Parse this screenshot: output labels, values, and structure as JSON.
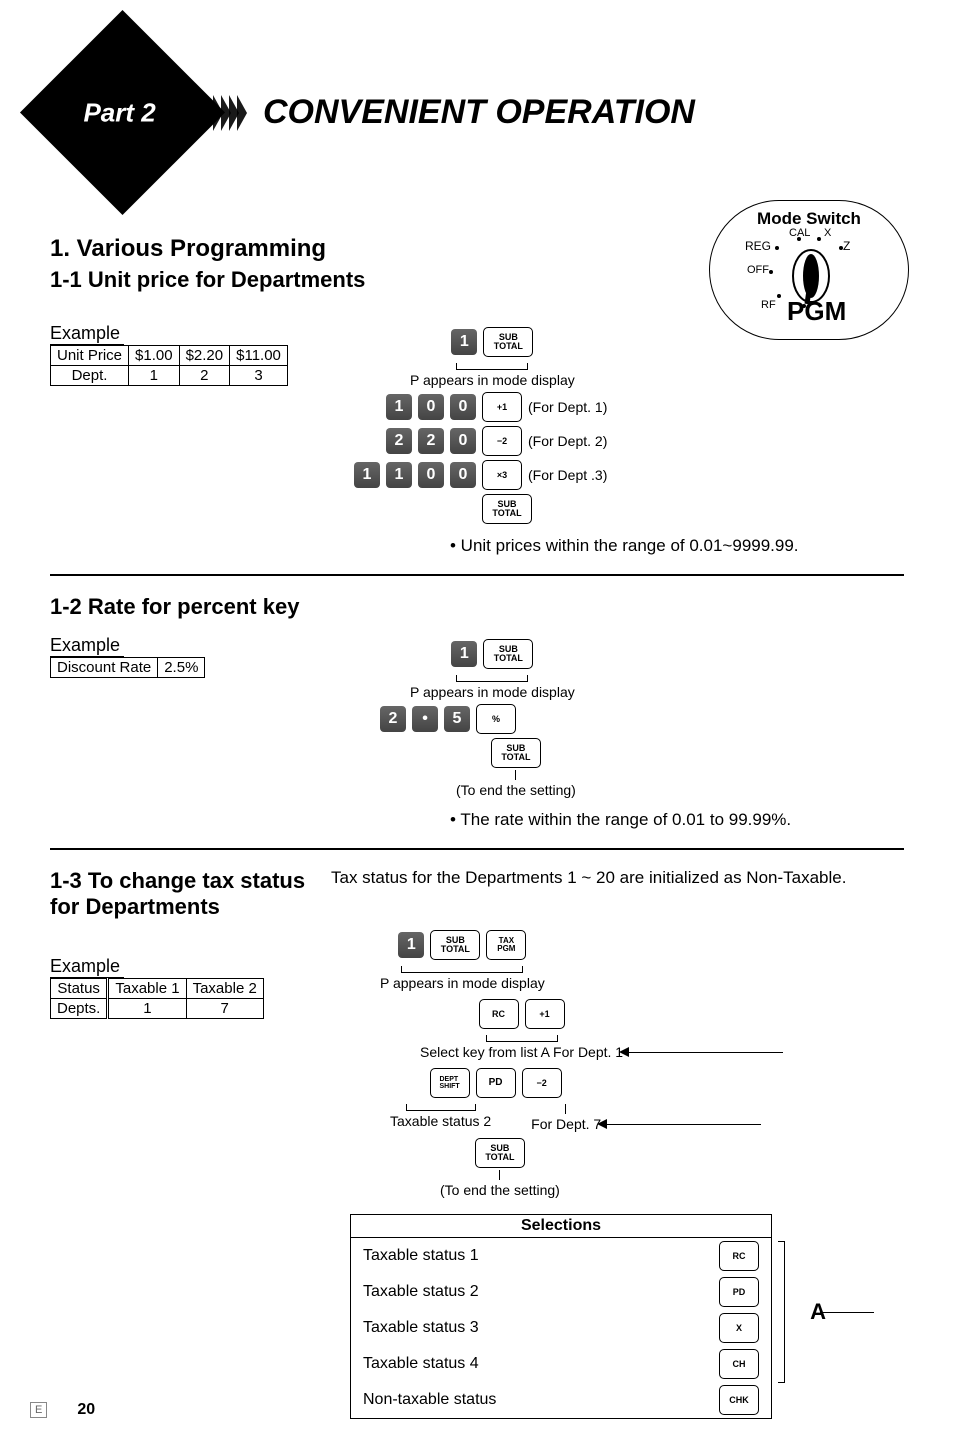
{
  "header": {
    "part_label": "Part 2",
    "title": "CONVENIENT OPERATION"
  },
  "mode_switch": {
    "title": "Mode Switch",
    "labels": {
      "reg": "REG",
      "cal": "CAL",
      "x": "X",
      "z": "Z",
      "off": "OFF",
      "rf": "RF",
      "pgm": "PGM"
    }
  },
  "sec1": {
    "heading": "1.   Various Programming",
    "sub": "1-1  Unit price for Departments",
    "example_label": "Example",
    "table": {
      "r1": [
        "Unit Price",
        "$1.00",
        "$2.20",
        "$11.00"
      ],
      "r2": [
        "Dept.",
        "1",
        "2",
        "3"
      ]
    },
    "mode_note": "P appears in mode display",
    "rows": [
      {
        "digits": [
          "1",
          "0",
          "0"
        ],
        "fn": "+1",
        "note": "(For Dept. 1)"
      },
      {
        "digits": [
          "2",
          "2",
          "0"
        ],
        "fn": "−2",
        "note": "(For Dept. 2)"
      },
      {
        "digits": [
          "1",
          "1",
          "0",
          "0"
        ],
        "fn": "×3",
        "note": "(For Dept .3)"
      }
    ],
    "footer_note": "• Unit prices within the range of 0.01~9999.99."
  },
  "sec2": {
    "sub": "1-2  Rate for percent key",
    "example_label": "Example",
    "table": {
      "r1": [
        "Discount Rate",
        "2.5%"
      ]
    },
    "mode_note": "P appears in mode display",
    "digits": [
      "2",
      "•",
      "5"
    ],
    "fn": "%",
    "end_note": "(To end the setting)",
    "footer_note": "• The rate within the range of 0.01 to 99.99%."
  },
  "sec3": {
    "sub": "1-3  To change tax status for Departments",
    "intro": "Tax status for the Departments 1 ~ 20 are initialized as Non-Taxable.",
    "example_label": "Example",
    "table": {
      "h": [
        "Status",
        "Taxable 1",
        "Taxable 2"
      ],
      "r": [
        "Depts.",
        "1",
        "7"
      ]
    },
    "mode_note": "P appears in mode display",
    "line1": "Select key from list A   For Dept. 1",
    "line2a": "Taxable status 2",
    "line2b": "For Dept. 7",
    "end_note": "(To end the setting)",
    "selections": {
      "title": "Selections",
      "rows": [
        {
          "label": "Taxable status 1",
          "key": "RC"
        },
        {
          "label": "Taxable status 2",
          "key": "PD"
        },
        {
          "label": "Taxable status 3",
          "key": "X"
        },
        {
          "label": "Taxable status 4",
          "key": "CH"
        },
        {
          "label": "Non-taxable status",
          "key": "CHK"
        }
      ],
      "bracket": "A"
    }
  },
  "subtotal_label_top": "SUB",
  "subtotal_label_bot": "TOTAL",
  "tax_pgm": "TAX PGM",
  "footer": {
    "e": "E",
    "page": "20"
  }
}
